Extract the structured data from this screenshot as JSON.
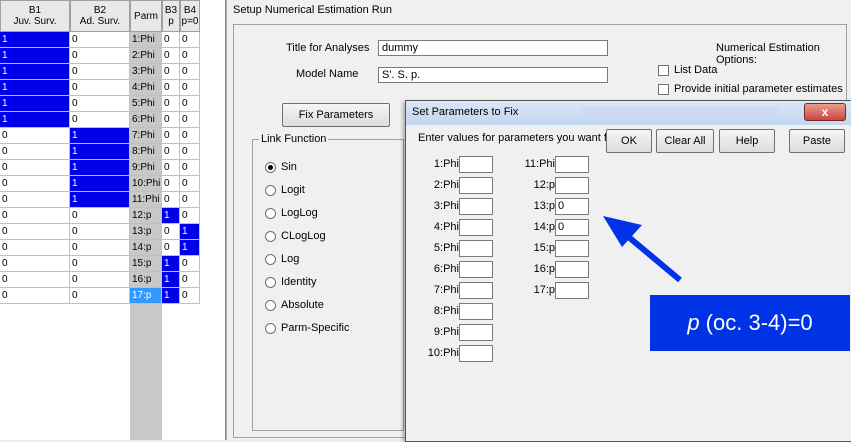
{
  "grid": {
    "headers": {
      "b1": "B1\nJuv. Surv.",
      "b2": "B2\nAd. Surv.",
      "parm": "Parm",
      "b3": "B3\np",
      "b4": "B4\np=0"
    },
    "rows": [
      {
        "b1": "1",
        "b2": "0",
        "parm": "1:Phi",
        "b3": "0",
        "b4": "0",
        "b1c": "blue",
        "b2c": "",
        "pc": "",
        "b3c": "",
        "b4c": ""
      },
      {
        "b1": "1",
        "b2": "0",
        "parm": "2:Phi",
        "b3": "0",
        "b4": "0",
        "b1c": "blue",
        "b2c": "",
        "pc": "",
        "b3c": "",
        "b4c": ""
      },
      {
        "b1": "1",
        "b2": "0",
        "parm": "3:Phi",
        "b3": "0",
        "b4": "0",
        "b1c": "blue",
        "b2c": "",
        "pc": "",
        "b3c": "",
        "b4c": ""
      },
      {
        "b1": "1",
        "b2": "0",
        "parm": "4:Phi",
        "b3": "0",
        "b4": "0",
        "b1c": "blue",
        "b2c": "",
        "pc": "",
        "b3c": "",
        "b4c": ""
      },
      {
        "b1": "1",
        "b2": "0",
        "parm": "5:Phi",
        "b3": "0",
        "b4": "0",
        "b1c": "blue",
        "b2c": "",
        "pc": "",
        "b3c": "",
        "b4c": ""
      },
      {
        "b1": "1",
        "b2": "0",
        "parm": "6:Phi",
        "b3": "0",
        "b4": "0",
        "b1c": "blue",
        "b2c": "",
        "pc": "",
        "b3c": "",
        "b4c": ""
      },
      {
        "b1": "0",
        "b2": "1",
        "parm": "7:Phi",
        "b3": "0",
        "b4": "0",
        "b1c": "",
        "b2c": "blue",
        "pc": "",
        "b3c": "",
        "b4c": ""
      },
      {
        "b1": "0",
        "b2": "1",
        "parm": "8:Phi",
        "b3": "0",
        "b4": "0",
        "b1c": "",
        "b2c": "blue",
        "pc": "",
        "b3c": "",
        "b4c": ""
      },
      {
        "b1": "0",
        "b2": "1",
        "parm": "9:Phi",
        "b3": "0",
        "b4": "0",
        "b1c": "",
        "b2c": "blue",
        "pc": "",
        "b3c": "",
        "b4c": ""
      },
      {
        "b1": "0",
        "b2": "1",
        "parm": "10:Phi",
        "b3": "0",
        "b4": "0",
        "b1c": "",
        "b2c": "blue",
        "pc": "",
        "b3c": "",
        "b4c": ""
      },
      {
        "b1": "0",
        "b2": "1",
        "parm": "11:Phi",
        "b3": "0",
        "b4": "0",
        "b1c": "",
        "b2c": "blue",
        "pc": "",
        "b3c": "",
        "b4c": ""
      },
      {
        "b1": "0",
        "b2": "0",
        "parm": "12:p",
        "b3": "1",
        "b4": "0",
        "b1c": "",
        "b2c": "",
        "pc": "",
        "b3c": "blue",
        "b4c": ""
      },
      {
        "b1": "0",
        "b2": "0",
        "parm": "13:p",
        "b3": "0",
        "b4": "1",
        "b1c": "",
        "b2c": "",
        "pc": "",
        "b3c": "",
        "b4c": "blue"
      },
      {
        "b1": "0",
        "b2": "0",
        "parm": "14:p",
        "b3": "0",
        "b4": "1",
        "b1c": "",
        "b2c": "",
        "pc": "",
        "b3c": "",
        "b4c": "blue"
      },
      {
        "b1": "0",
        "b2": "0",
        "parm": "15:p",
        "b3": "1",
        "b4": "0",
        "b1c": "",
        "b2c": "",
        "pc": "",
        "b3c": "blue",
        "b4c": ""
      },
      {
        "b1": "0",
        "b2": "0",
        "parm": "16:p",
        "b3": "1",
        "b4": "0",
        "b1c": "",
        "b2c": "",
        "pc": "",
        "b3c": "blue",
        "b4c": ""
      },
      {
        "b1": "0",
        "b2": "0",
        "parm": "17:p",
        "b3": "1",
        "b4": "0",
        "b1c": "",
        "b2c": "",
        "pc": "lblue",
        "b3c": "blue",
        "b4c": ""
      }
    ]
  },
  "setup": {
    "title": "Setup Numerical Estimation Run",
    "title_label": "Title for Analyses",
    "title_value": "dummy",
    "model_label": "Model Name",
    "model_value": "S'. S. p.",
    "options_title": "Numerical Estimation Options:",
    "opt_list_data": "List Data",
    "opt_initial": "Provide initial parameter estimates",
    "fix_button": "Fix Parameters",
    "link_function_label": "Link Function",
    "link_options": [
      "Sin",
      "Logit",
      "LogLog",
      "CLogLog",
      "Log",
      "Identity",
      "Absolute",
      "Parm-Specific"
    ],
    "link_selected": "Sin"
  },
  "fix_dialog": {
    "title": "Set Parameters to Fix",
    "close": "x",
    "prompt": "Enter values for parameters you want fixed",
    "ok": "OK",
    "clear_all": "Clear All",
    "help": "Help",
    "paste": "Paste",
    "left_params": [
      {
        "label": "1:Phi",
        "value": ""
      },
      {
        "label": "2:Phi",
        "value": ""
      },
      {
        "label": "3:Phi",
        "value": ""
      },
      {
        "label": "4:Phi",
        "value": ""
      },
      {
        "label": "5:Phi",
        "value": ""
      },
      {
        "label": "6:Phi",
        "value": ""
      },
      {
        "label": "7:Phi",
        "value": ""
      },
      {
        "label": "8:Phi",
        "value": ""
      },
      {
        "label": "9:Phi",
        "value": ""
      },
      {
        "label": "10:Phi",
        "value": ""
      }
    ],
    "right_params": [
      {
        "label": "11:Phi",
        "value": ""
      },
      {
        "label": "12:p",
        "value": ""
      },
      {
        "label": "13:p",
        "value": "0"
      },
      {
        "label": "14:p",
        "value": "0"
      },
      {
        "label": "15:p",
        "value": ""
      },
      {
        "label": "16:p",
        "value": ""
      },
      {
        "label": "17:p",
        "value": ""
      }
    ]
  },
  "annotation": {
    "italic": "p",
    "text": " (oc. 3-4)=0",
    "color": "#0033e6"
  }
}
